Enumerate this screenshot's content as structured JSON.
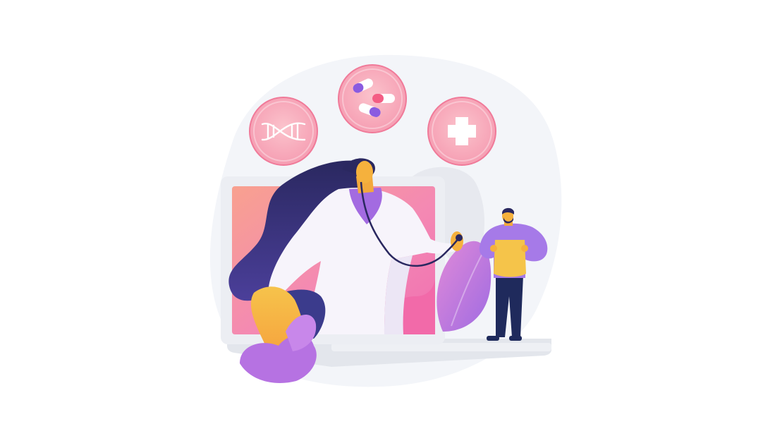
{
  "illustration": {
    "theme": "telemedicine",
    "colors": {
      "background": "#ffffff",
      "blob": "#f2f4f8",
      "laptop_frame": "#eceef3",
      "laptop_base": "#dfe3ea",
      "screen_pink": "#f47fb0",
      "screen_salmon": "#f7958d",
      "doctor_hair": "#2b2a6b",
      "doctor_coat": "#f6f3fa",
      "doctor_shirt": "#a26be0",
      "skin": "#f5b13d",
      "patient_shirt": "#a67ae8",
      "patient_vest": "#f5c44a",
      "patient_pants": "#1f2a5c",
      "plant_purple": "#c17ae6",
      "badge_fill": "#f7a8b8",
      "badge_ring": "#f07a99"
    },
    "badges": [
      {
        "name": "dna",
        "icon": "dna-icon"
      },
      {
        "name": "pills",
        "icon": "pills-icon"
      },
      {
        "name": "medical-cross",
        "icon": "medical-cross-icon"
      }
    ]
  }
}
